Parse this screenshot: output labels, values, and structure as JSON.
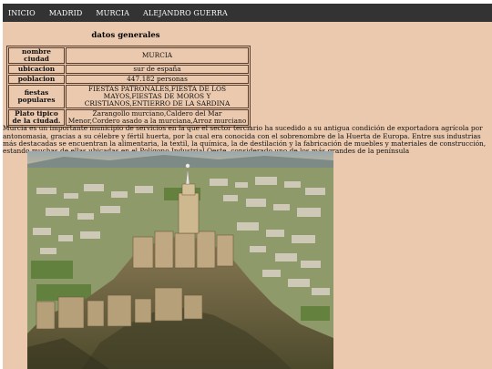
{
  "nav": {
    "items": [
      "INICIO",
      "MADRID",
      "MURCIA",
      "ALEJANDRO GUERRA"
    ]
  },
  "section": {
    "title": "datos generales"
  },
  "table": {
    "rows": [
      {
        "key": "nombre ciudad",
        "value": "MURCIA"
      },
      {
        "key": "ubicacion",
        "value": "sur de españa"
      },
      {
        "key": "poblacion",
        "value": "447.182 personas"
      },
      {
        "key": "fiestas populares",
        "value": "FIESTAS PATRONALES,FIESTA DE LOS MAYOS,FIESTAS DE MOROS Y CRISTIANOS,ENTIERRO DE LA SARDINA"
      },
      {
        "key": "Plato tipico de la ciudad.",
        "value": "Zarangollo murciano,Caldero del Mar Menor,Cordero asado a la murciana,Arroz murciano"
      }
    ]
  },
  "description": "Murcia es un importante municipio de servicios en la que el sector terciario ha sucedido a su antigua condición de exportadora agrícola por antonomasia, gracias a su célebre y fértil huerta, por la cual era conocida con el sobrenombre de la Huerta de Europa. Entre sus industrias más destacadas se encuentran la alimentaria, la textil, la química, la de destilación y la fabricación de muebles y materiales de construcción, estando muchas de ellas ubicadas en el Polígono Industrial Oeste, considerado uno de los más grandes de la península",
  "colors": {
    "page_bg": "#eac9ae",
    "nav_bg": "#333333",
    "nav_text": "#ffffff",
    "table_border": "#5a3e2b"
  },
  "photo": {
    "subject": "castle-hilltop-aerial-photo"
  }
}
